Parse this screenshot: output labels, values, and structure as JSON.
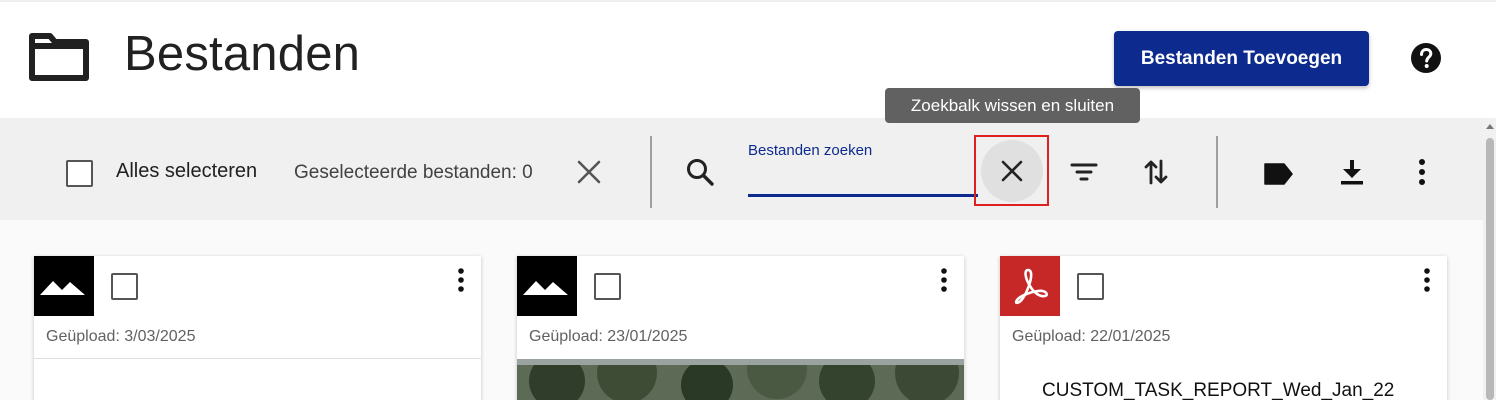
{
  "header": {
    "title": "Bestanden",
    "add_button_label": "Bestanden Toevoegen",
    "folder_icon": "folder-icon",
    "help_icon": "help-circle-icon",
    "accent_color": "#0d2b8f"
  },
  "tooltip": {
    "text": "Zoekbalk wissen en sluiten"
  },
  "toolbar": {
    "select_all_label": "Alles selecteren",
    "selected_count_label": "Geselecteerde bestanden: 0",
    "search_label": "Bestanden zoeken",
    "search_value": "",
    "icons": [
      "close-icon",
      "search-icon",
      "clear-search-icon",
      "filter-icon",
      "sort-icon",
      "tag-icon",
      "download-icon",
      "more-vert-icon"
    ],
    "highlight_color": "#e02020"
  },
  "cards": [
    {
      "type": "image",
      "date": "Geüpload: 3/03/2025",
      "thumb_color": "#000000",
      "checked": false
    },
    {
      "type": "image",
      "date": "Geüpload: 23/01/2025",
      "thumb_color": "#000000",
      "checked": false
    },
    {
      "type": "pdf",
      "date": "Geüpload: 22/01/2025",
      "thumb_color": "#c62828",
      "checked": false,
      "preview_title": "CUSTOM_TASK_REPORT_Wed_Jan_22"
    }
  ]
}
